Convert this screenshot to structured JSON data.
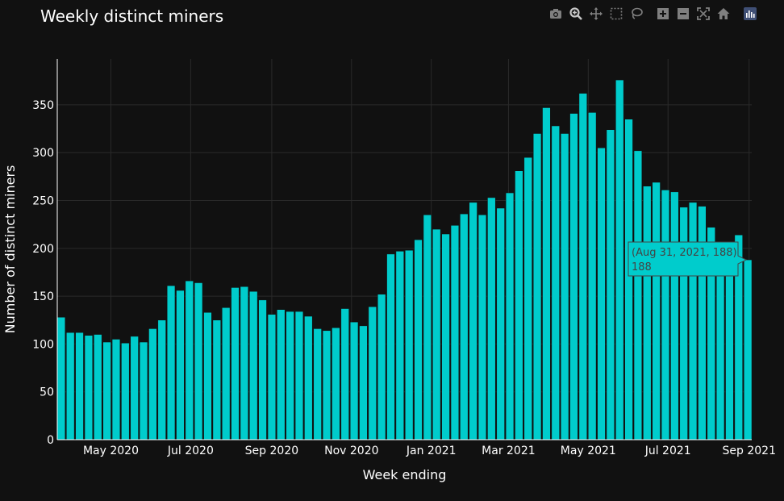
{
  "modebar": {
    "icons": [
      "camera-icon",
      "zoom-icon",
      "pan-icon",
      "box-select-icon",
      "lasso-icon",
      "zoom-in-icon",
      "zoom-out-icon",
      "autoscale-icon",
      "home-icon",
      "plotly-logo-icon"
    ]
  },
  "chart_data": {
    "type": "bar",
    "title": "Weekly distinct miners",
    "xlabel": "Week ending",
    "ylabel": "Number of distinct miners",
    "ylim": [
      0,
      398
    ],
    "yticks": [
      0,
      50,
      100,
      150,
      200,
      250,
      300,
      350
    ],
    "xticks": [
      {
        "date": "2020-05-01",
        "label": "May 2020"
      },
      {
        "date": "2020-07-01",
        "label": "Jul 2020"
      },
      {
        "date": "2020-09-01",
        "label": "Sep 2020"
      },
      {
        "date": "2020-11-01",
        "label": "Nov 2020"
      },
      {
        "date": "2021-01-01",
        "label": "Jan 2021"
      },
      {
        "date": "2021-03-01",
        "label": "Mar 2021"
      },
      {
        "date": "2021-05-01",
        "label": "May 2021"
      },
      {
        "date": "2021-07-01",
        "label": "Jul 2021"
      },
      {
        "date": "2021-09-01",
        "label": "Sep 2021"
      }
    ],
    "bar_color": "#00cccc",
    "grid": true,
    "x": [
      "2020-03-24",
      "2020-03-31",
      "2020-04-07",
      "2020-04-14",
      "2020-04-21",
      "2020-04-28",
      "2020-05-05",
      "2020-05-12",
      "2020-05-19",
      "2020-05-26",
      "2020-06-02",
      "2020-06-09",
      "2020-06-16",
      "2020-06-23",
      "2020-06-30",
      "2020-07-07",
      "2020-07-14",
      "2020-07-21",
      "2020-07-28",
      "2020-08-04",
      "2020-08-11",
      "2020-08-18",
      "2020-08-25",
      "2020-09-01",
      "2020-09-08",
      "2020-09-15",
      "2020-09-22",
      "2020-09-29",
      "2020-10-06",
      "2020-10-13",
      "2020-10-20",
      "2020-10-27",
      "2020-11-03",
      "2020-11-10",
      "2020-11-17",
      "2020-11-24",
      "2020-12-01",
      "2020-12-08",
      "2020-12-15",
      "2020-12-22",
      "2020-12-29",
      "2021-01-05",
      "2021-01-12",
      "2021-01-19",
      "2021-01-26",
      "2021-02-02",
      "2021-02-09",
      "2021-02-16",
      "2021-02-23",
      "2021-03-02",
      "2021-03-09",
      "2021-03-16",
      "2021-03-23",
      "2021-03-30",
      "2021-04-06",
      "2021-04-13",
      "2021-04-20",
      "2021-04-27",
      "2021-05-04",
      "2021-05-11",
      "2021-05-18",
      "2021-05-25",
      "2021-06-01",
      "2021-06-08",
      "2021-06-15",
      "2021-06-22",
      "2021-06-29",
      "2021-07-06",
      "2021-07-13",
      "2021-07-20",
      "2021-07-27",
      "2021-08-03",
      "2021-08-10",
      "2021-08-17",
      "2021-08-24",
      "2021-08-31"
    ],
    "values": [
      128,
      112,
      112,
      109,
      110,
      102,
      105,
      101,
      108,
      102,
      116,
      125,
      161,
      156,
      166,
      164,
      133,
      125,
      138,
      159,
      160,
      155,
      146,
      131,
      136,
      134,
      134,
      129,
      116,
      114,
      117,
      137,
      123,
      119,
      139,
      152,
      194,
      197,
      198,
      209,
      235,
      220,
      215,
      224,
      236,
      248,
      235,
      253,
      242,
      258,
      281,
      295,
      320,
      347,
      328,
      320,
      341,
      362,
      342,
      305,
      324,
      376,
      335,
      302,
      265,
      269,
      261,
      259,
      243,
      248,
      244,
      222,
      202,
      201,
      214,
      188
    ],
    "tooltip": {
      "line1": "(Aug 31, 2021, 188)",
      "line2": "188",
      "bg": "#00cccc",
      "border": "#444444"
    }
  }
}
